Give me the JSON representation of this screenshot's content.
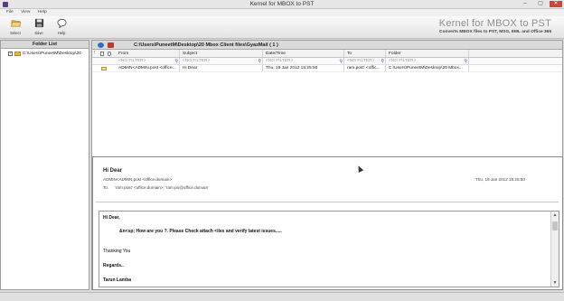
{
  "window": {
    "title": "Kernel for MBOX to PST",
    "controls": [
      "–",
      "▢",
      "✕"
    ]
  },
  "menu": [
    "File",
    "View",
    "Help"
  ],
  "toolbar": {
    "buttons": [
      {
        "label": "Select",
        "icon": "folder-open-icon"
      },
      {
        "label": "Save",
        "icon": "save-icon"
      },
      {
        "label": "Help",
        "icon": "help-icon"
      }
    ],
    "brand_name": "Kernel for MBOX to PST",
    "brand_tagline": "Converts MBOX files to PST, MSG, EML and Office 365"
  },
  "folder_list": {
    "header": "Folder List",
    "items": [
      {
        "label": "C:\\Users\\PuneetM\\Desktop\\20",
        "checked": true
      }
    ]
  },
  "path_bar": {
    "text": "C:\\Users\\PuneetM\\Desktop\\20 Mbox Client files\\GyazMail ( 1 )"
  },
  "grid": {
    "columns": [
      "From",
      "Subject",
      "Date/Time",
      "To",
      "Folder"
    ],
    "filter": "<NO FILTER>",
    "rows": [
      {
        "from": "ADMIN<ADMIN.post <office...",
        "subject": "Hi Dear",
        "date": "Thu, 19 Jan 2012 15:25:50",
        "to": "ram.post' <offic...",
        "folder": "C:\\Users\\PuneetM\\Desktop\\20 Mbox..."
      }
    ]
  },
  "preview": {
    "subject": "Hi Dear",
    "from": "ADMIN<ADMIN.post <office.domain>",
    "date": "Thu, 19 Jan 2012 15:25:50",
    "to_label": "To:",
    "to": "'ram.post' <office.domain>, 'ram.po@office.domain'",
    "body": {
      "greeting": "Hi Dear,",
      "main": "&n<sp;   How are you ?. Please Check attach <iles and verify latest issues.....",
      "thanks": "Thanking You",
      "regards": "Regards..",
      "signature": "Tarun Lamba"
    }
  },
  "colors": {
    "close_button": "#c9463d",
    "path_icon_blue": "#2f6fc4",
    "path_icon_red": "#c0392b",
    "folder_yellow": "#e8b84a"
  }
}
